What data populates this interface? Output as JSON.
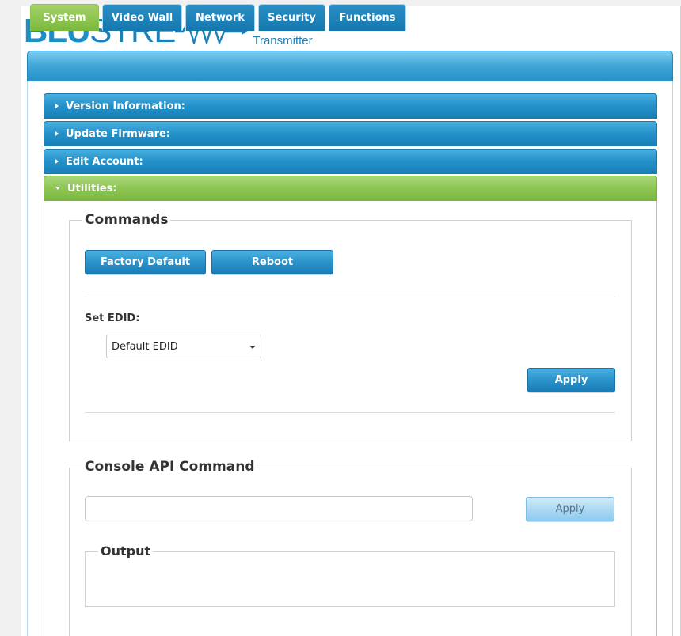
{
  "brand": {
    "name_bold": "BLU",
    "name_rest": "STRE",
    "subtitle": "Transmitter",
    "color_primary": "#1c8fc7",
    "color_secondary": "#1c7fb8"
  },
  "tabs": [
    {
      "label": "System",
      "active": true
    },
    {
      "label": "Video Wall",
      "active": false
    },
    {
      "label": "Network",
      "active": false
    },
    {
      "label": "Security",
      "active": false
    },
    {
      "label": "Functions",
      "active": false
    }
  ],
  "accordion": [
    {
      "label": "Version Information:",
      "open": false
    },
    {
      "label": "Update Firmware:",
      "open": false
    },
    {
      "label": "Edit Account:",
      "open": false
    },
    {
      "label": "Utilities:",
      "open": true
    }
  ],
  "commands": {
    "legend": "Commands",
    "factory_default_label": "Factory Default",
    "reboot_label": "Reboot",
    "set_edid_label": "Set EDID:",
    "edid_selected": "Default EDID",
    "apply_label": "Apply"
  },
  "console": {
    "legend": "Console API Command",
    "input_value": "",
    "apply_label": "Apply",
    "output_legend": "Output",
    "output_text": ""
  },
  "colors": {
    "accent_blue": "#2391c9",
    "accent_green": "#8ec653"
  }
}
